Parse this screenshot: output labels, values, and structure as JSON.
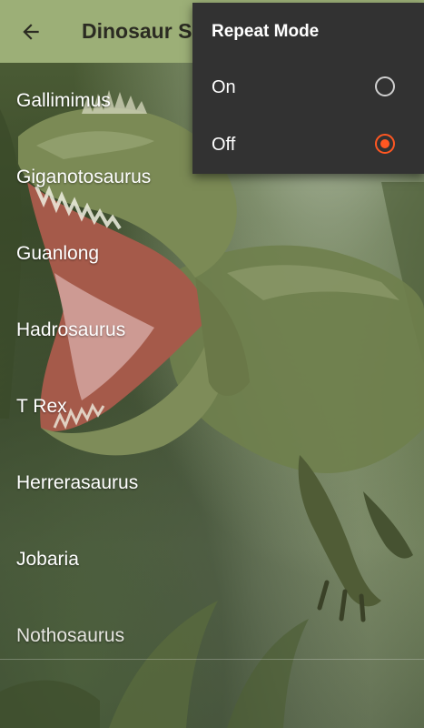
{
  "appbar": {
    "title": "Dinosaur Sounds",
    "back_icon": "arrow-left-icon",
    "color": "#9caf77"
  },
  "list": {
    "items": [
      {
        "label": "Gallimimus"
      },
      {
        "label": "Giganotosaurus"
      },
      {
        "label": "Guanlong"
      },
      {
        "label": "Hadrosaurus"
      },
      {
        "label": "T Rex"
      },
      {
        "label": "Herrerasaurus"
      },
      {
        "label": "Jobaria"
      },
      {
        "label": "Nothosaurus"
      }
    ]
  },
  "popup": {
    "title": "Repeat Mode",
    "options": [
      {
        "label": "On",
        "selected": false
      },
      {
        "label": "Off",
        "selected": true
      }
    ],
    "accent_color": "#ff5722"
  }
}
